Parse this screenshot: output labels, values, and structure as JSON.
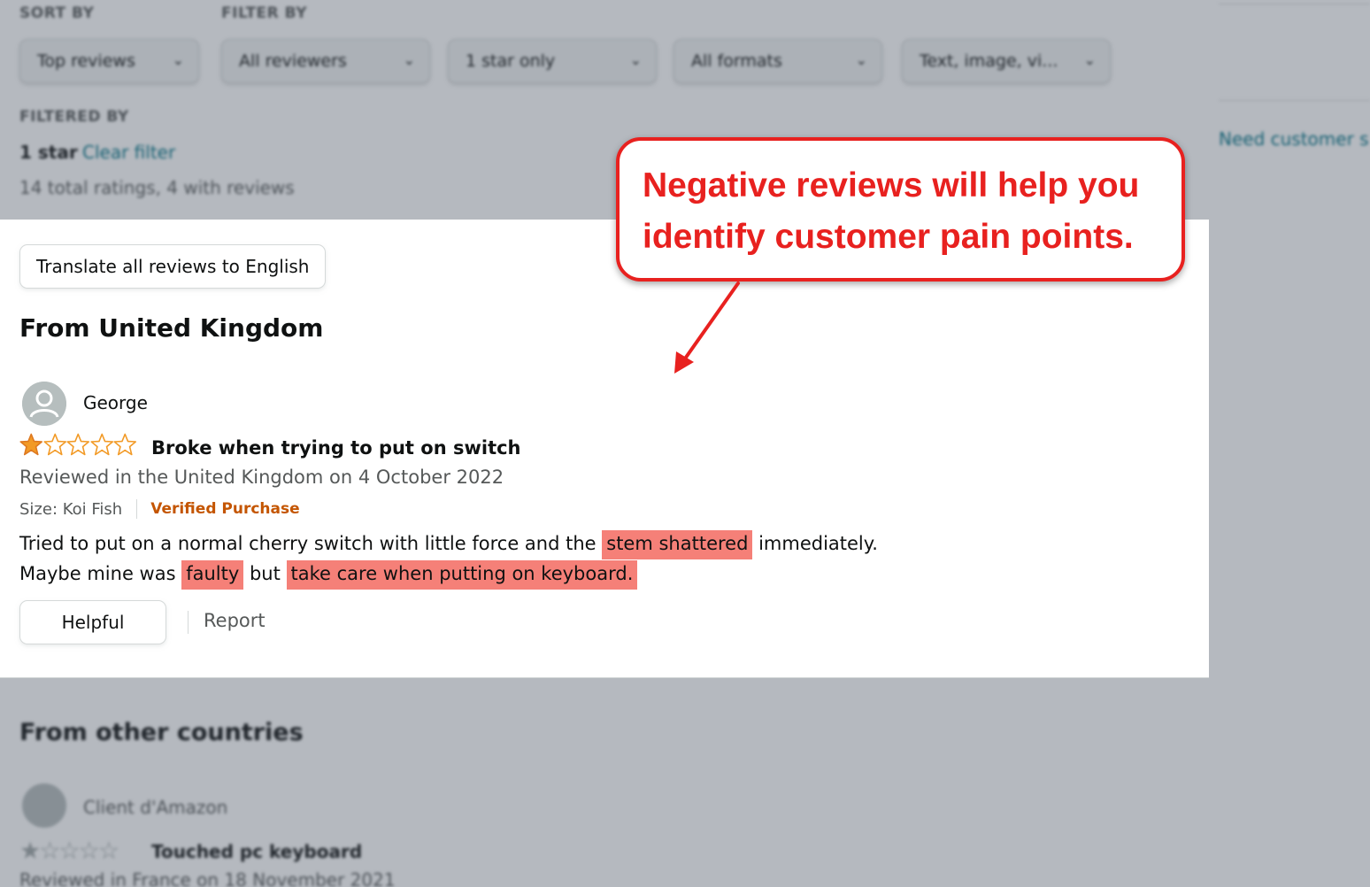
{
  "background": {
    "sort_label": "SORT BY",
    "filter_label": "FILTER BY",
    "dropdowns": [
      {
        "value": "Top reviews"
      },
      {
        "value": "All reviewers"
      },
      {
        "value": "1 star only"
      },
      {
        "value": "All formats"
      },
      {
        "value": "Text, image, vi..."
      }
    ],
    "filtered_by_label": "FILTERED BY",
    "filter_value": "1 star",
    "clear_filter": "Clear filter",
    "ratings_summary": "14 total ratings, 4 with reviews",
    "right_rail_text": "Need customer s",
    "other_countries_title": "From other countries",
    "other_reviewer": "Client d'Amazon",
    "other_review_title": "Touched pc keyboard",
    "other_review_date": "Reviewed in France on 18 November 2021"
  },
  "panel": {
    "translate_button": "Translate all reviews to English",
    "section_title": "From United Kingdom",
    "review": {
      "reviewer": "George",
      "rating": 1,
      "max_rating": 5,
      "title": "Broke when trying to put on switch",
      "date": "Reviewed in the United Kingdom on 4 October 2022",
      "size": "Size: Koi Fish",
      "verified": "Verified Purchase",
      "line1_a": "Tried to put on a normal cherry switch with little force and the ",
      "line1_hl": "stem shattered",
      "line1_b": " immediately.",
      "line2_a": "Maybe mine was ",
      "line2_hl1": "faulty",
      "line2_b": " but ",
      "line2_hl2": "take care when putting on keyboard."
    },
    "helpful_button": "Helpful",
    "report_link": "Report"
  },
  "callout": {
    "line1": "Negative reviews will help you",
    "line2": "identify customer pain points."
  },
  "colors": {
    "callout_red": "#e8211f",
    "highlight": "#f58078",
    "verified": "#c45500",
    "star": "#f29a26"
  }
}
